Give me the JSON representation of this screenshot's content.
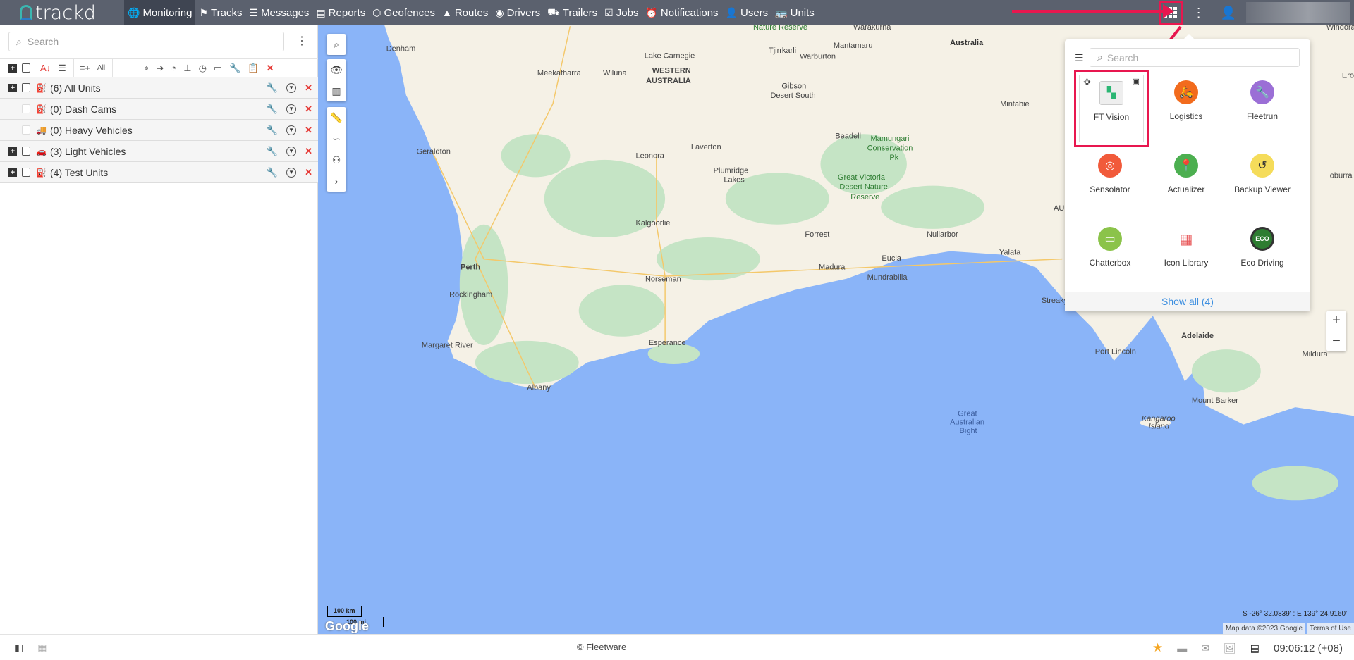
{
  "header": {
    "logo": "trackd",
    "nav": [
      {
        "label": "Monitoring",
        "icon": "globe-icon",
        "active": true
      },
      {
        "label": "Tracks",
        "icon": "flag-icon"
      },
      {
        "label": "Messages",
        "icon": "messages-icon"
      },
      {
        "label": "Reports",
        "icon": "reports-icon"
      },
      {
        "label": "Geofences",
        "icon": "geofence-icon"
      },
      {
        "label": "Routes",
        "icon": "routes-icon"
      },
      {
        "label": "Drivers",
        "icon": "steering-wheel-icon"
      },
      {
        "label": "Trailers",
        "icon": "trailer-icon"
      },
      {
        "label": "Jobs",
        "icon": "clipboard-icon"
      },
      {
        "label": "Notifications",
        "icon": "alarm-icon"
      },
      {
        "label": "Users",
        "icon": "user-icon"
      },
      {
        "label": "Units",
        "icon": "bus-icon"
      }
    ]
  },
  "sidebar": {
    "search_placeholder": "Search",
    "toolbar_all": "All",
    "groups": [
      {
        "label": "(6) All Units",
        "expandable": true
      },
      {
        "label": "(0) Dash Cams",
        "expandable": false
      },
      {
        "label": "(0) Heavy Vehicles",
        "expandable": false
      },
      {
        "label": "(3) Light Vehicles",
        "expandable": true
      },
      {
        "label": "(4) Test Units",
        "expandable": true
      }
    ]
  },
  "apps_popup": {
    "search_placeholder": "Search",
    "apps": [
      {
        "label": "FT Vision",
        "color": "#2bb673",
        "selected": true
      },
      {
        "label": "Logistics",
        "color": "#f26b1d"
      },
      {
        "label": "Fleetrun",
        "color": "#9b6fd6"
      },
      {
        "label": "Sensolator",
        "color": "#f15a3a"
      },
      {
        "label": "Actualizer",
        "color": "#f15a3a"
      },
      {
        "label": "Backup Viewer",
        "color": "#f5dc5a"
      },
      {
        "label": "Chatterbox",
        "color": "#8bc34a"
      },
      {
        "label": "Icon Library",
        "color": "#e8585a"
      },
      {
        "label": "Eco Driving",
        "color": "#2e7d32"
      }
    ],
    "show_all": "Show all (4)"
  },
  "map": {
    "coords": "S -26° 32.0839' : E 139° 24.9160'",
    "attribution": "Map data ©2023 Google",
    "terms": "Terms of Use",
    "scale_km": "100 km",
    "scale_mi": "100 mi",
    "google": "Google",
    "labels": [
      "Denham",
      "Meekatharra",
      "Wiluna",
      "Lake Carnegie",
      "WESTERN",
      "AUSTRALIA",
      "Tjirrkarli",
      "Warburton",
      "Mantamaru",
      "Nature Reserve",
      "Warakurna",
      "Gibson",
      "Desert South",
      "Geraldton",
      "Leonora",
      "Laverton",
      "Plumridge",
      "Lakes",
      "Beadell",
      "Mamungari",
      "Conservation",
      "Pk",
      "Great Victoria",
      "Desert Nature",
      "Reserve",
      "Kalgoorlie",
      "Forrest",
      "Nullarbor",
      "Yalata",
      "Eucla",
      "Madura",
      "Mundrabilla",
      "Perth",
      "Norseman",
      "Rockingham",
      "Esperance",
      "Margaret River",
      "Albany",
      "Great",
      "Australian",
      "Bight",
      "Port Lincoln",
      "Adelaide",
      "Mount Barker",
      "Kangaroo",
      "Island",
      "Mildura",
      "Mintabie",
      "Australia",
      "AU",
      "Streaky",
      "Windorah",
      "Erom",
      "oburra"
    ]
  },
  "footer": {
    "copyright": "© Fleetware",
    "time": "09:06:12 (+08)"
  },
  "colors": {
    "topbar": "#5b616e",
    "highlight": "#e8174f",
    "ocean": "#8ab4f8",
    "land": "#f5f1e6",
    "link": "#3d8fe0"
  }
}
